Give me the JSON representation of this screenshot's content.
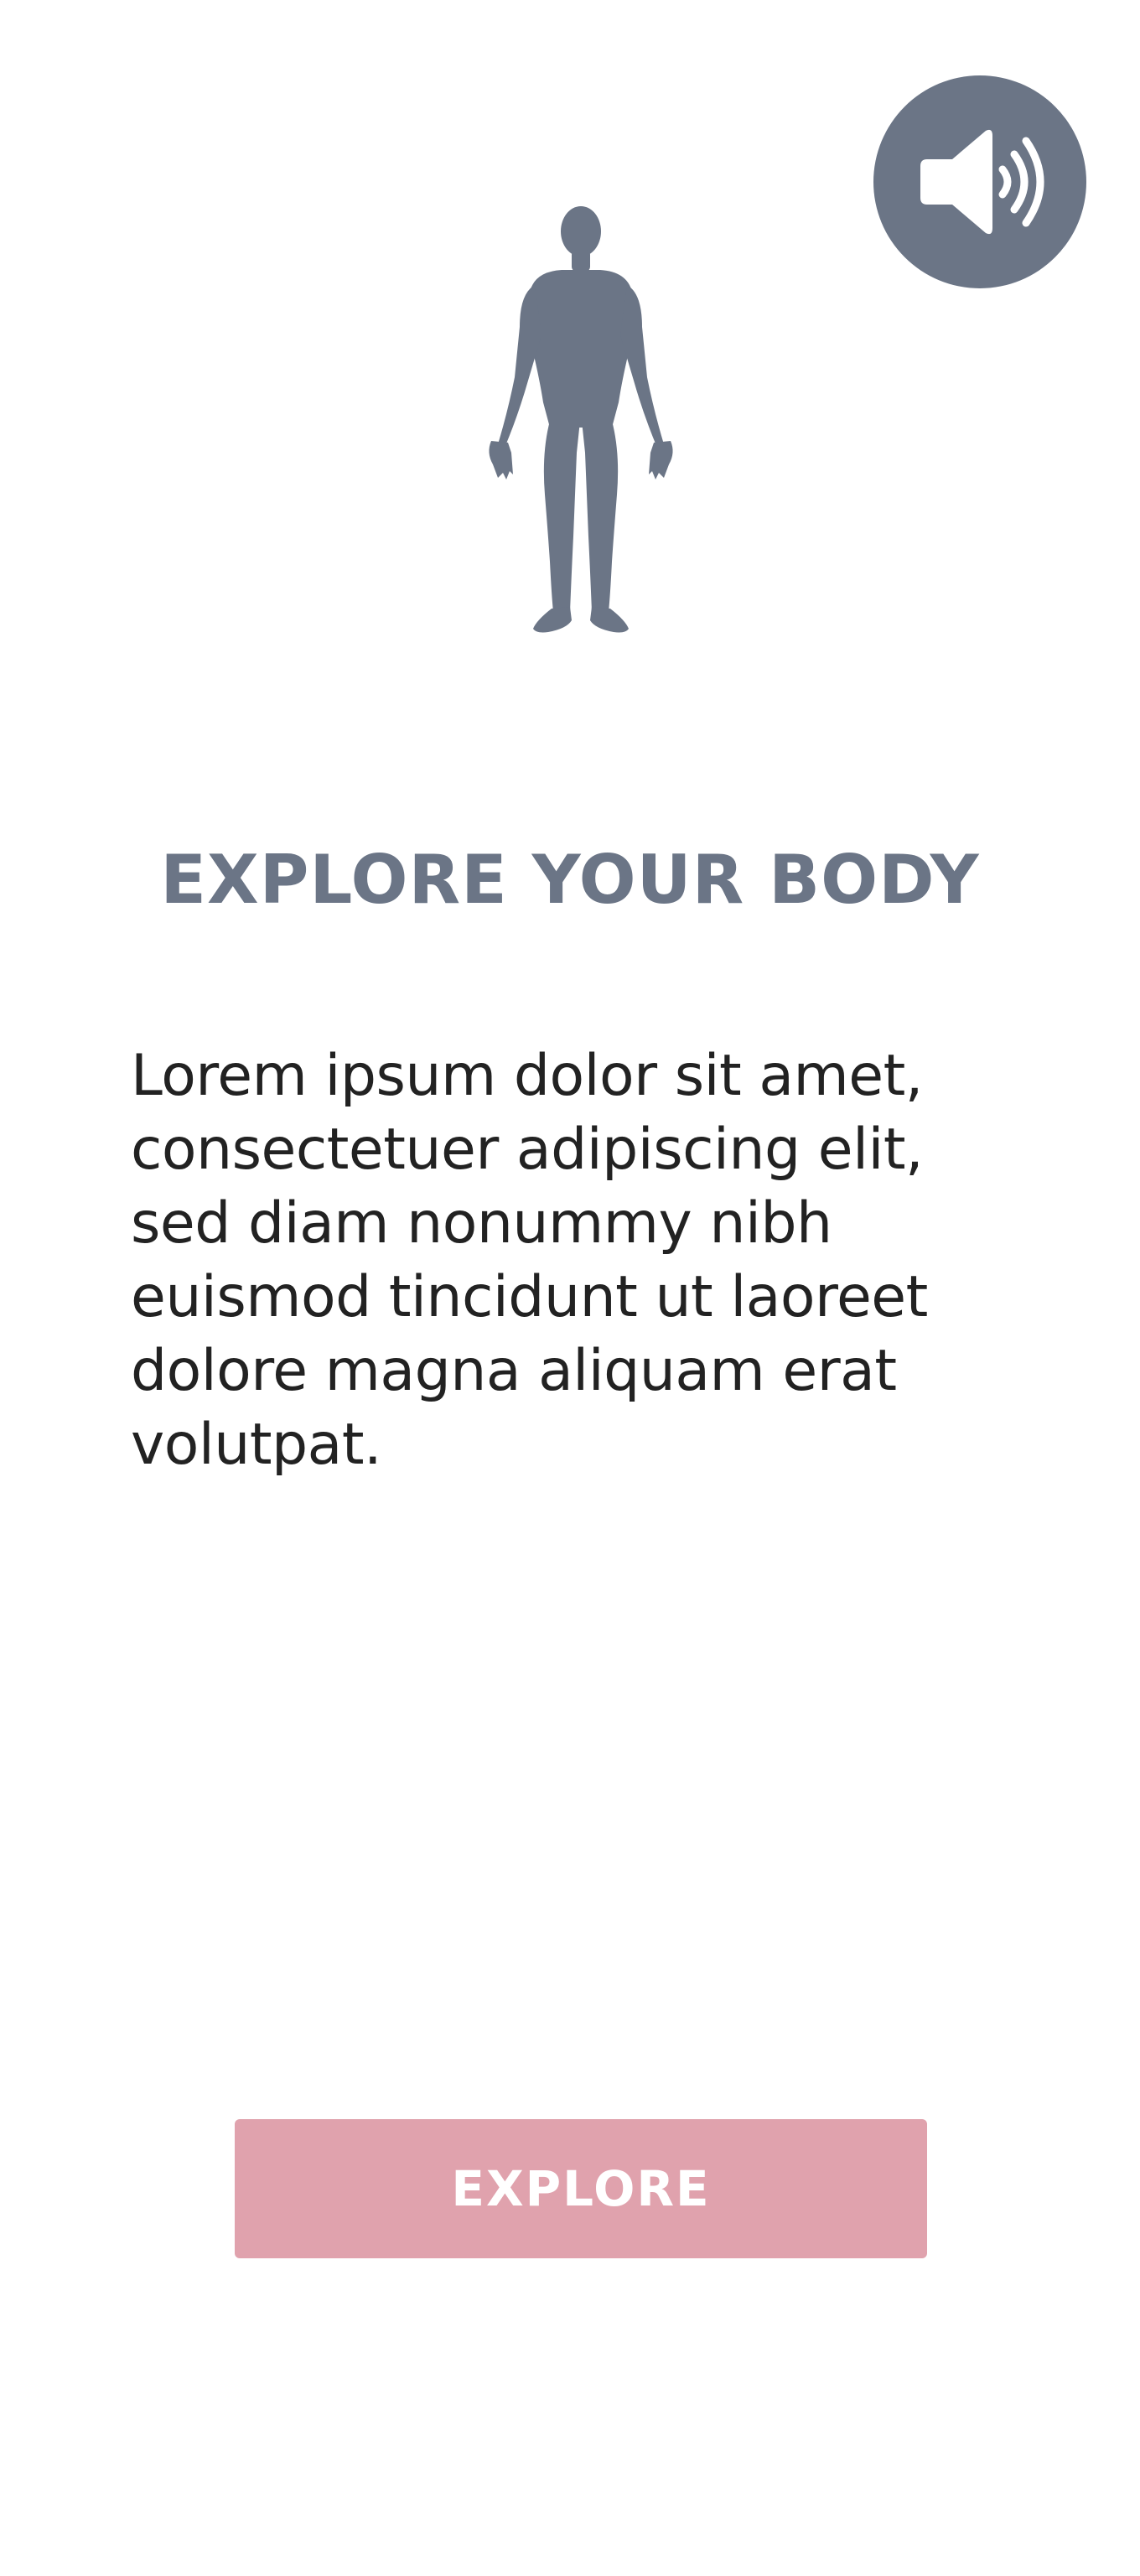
{
  "screen": {
    "title": "EXPLORE YOUR BODY",
    "description": "Lorem ipsum dolor sit amet, consectetuer adipiscing elit, sed diam nonummy nibh euismod tincidunt ut laoreet dolore magna aliquam erat volutpat."
  },
  "actions": {
    "explore_label": "EXPLORE"
  },
  "icons": {
    "sound": "speaker-volume-icon",
    "figure": "human-body-icon"
  },
  "colors": {
    "accent_gray": "#6b7586",
    "button_pink": "#e0a2ad",
    "text": "#222222",
    "background": "#ffffff"
  }
}
